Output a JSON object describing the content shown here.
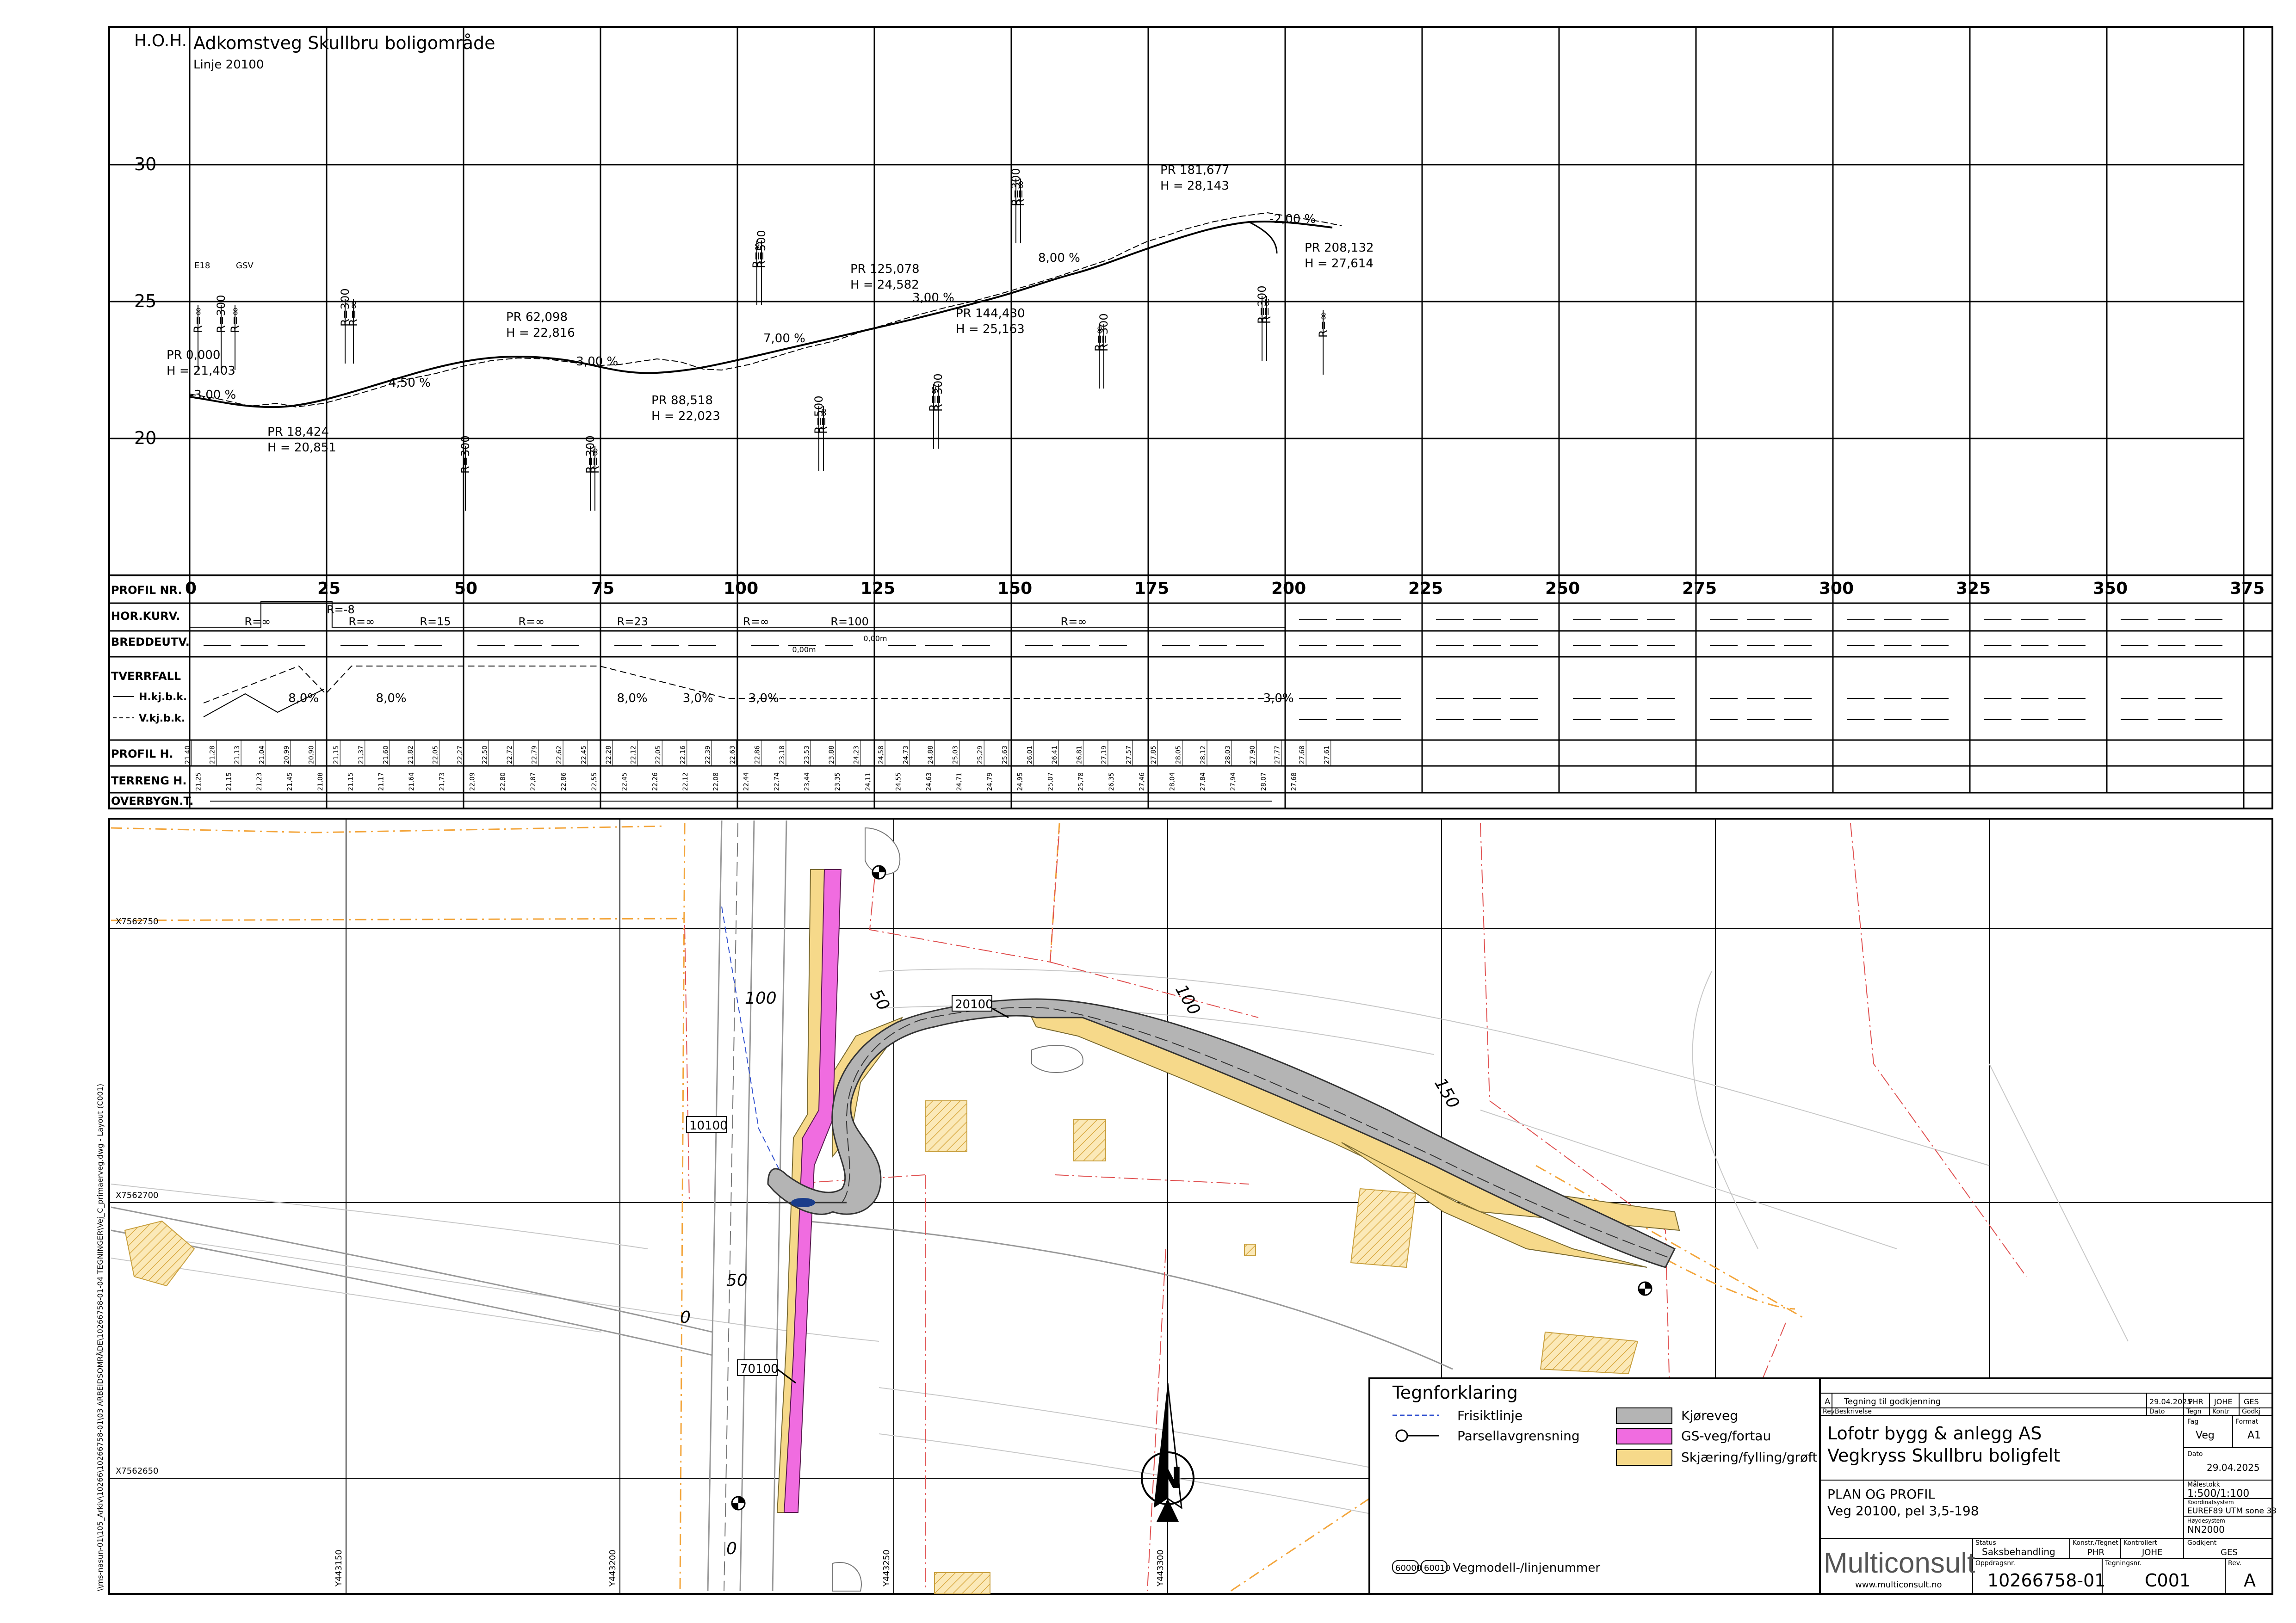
{
  "profile": {
    "title": "Adkomstveg Skullbru boligområde",
    "line": "Linje 20100",
    "hoh_label": "H.O.H.",
    "elevation_ticks": [
      "30",
      "25",
      "20"
    ],
    "station_ticks": [
      "0",
      "25",
      "50",
      "75",
      "100",
      "125",
      "150",
      "175",
      "200",
      "225",
      "250",
      "275",
      "300",
      "325",
      "350",
      "375"
    ],
    "points": [
      {
        "pr": "PR 0,000",
        "h": "H = 21,403"
      },
      {
        "pr": "PR 18,424",
        "h": "H = 20,851"
      },
      {
        "pr": "PR 62,098",
        "h": "H = 22,816"
      },
      {
        "pr": "PR 88,518",
        "h": "H = 22,023"
      },
      {
        "pr": "PR 125,078",
        "h": "H = 24,582"
      },
      {
        "pr": "PR 144,430",
        "h": "H = 25,163"
      },
      {
        "pr": "PR 181,677",
        "h": "H = 28,143"
      },
      {
        "pr": "PR 208,132",
        "h": "H = 27,614"
      }
    ],
    "grades": [
      "-3,00 %",
      "4,50 %",
      "-3,00 %",
      "7,00 %",
      "3,00 %",
      "8,00 %",
      "-2,00 %"
    ],
    "curve_labels": [
      "R=∞",
      "R=300",
      "R=∞",
      "R=300",
      "R=∞",
      "R=300",
      "R=300",
      "R=∞",
      "R=∞",
      "R=500",
      "R=500",
      "R=∞",
      "R=∞",
      "R=300",
      "R=300",
      "R=∞",
      "R=∞",
      "R=300",
      "R=300",
      "R=∞",
      "R=∞"
    ],
    "small_labels": [
      "E18",
      "GSV"
    ]
  },
  "bands": {
    "labels": [
      "PROFIL NR.",
      "HOR.KURV.",
      "BREDDEUTV.",
      "TVERRFALL",
      "H.kj.b.k.",
      "V.kj.b.k.",
      "PROFIL H.",
      "TERRENG H.",
      "OVERBYGN.T."
    ],
    "hor_kurv": [
      "R=∞",
      "R=-8",
      "R=∞",
      "R=15",
      "R=∞",
      "R=23",
      "R=∞",
      "R=100",
      "R=∞"
    ],
    "bredde": [
      "0,00m",
      "0,00m"
    ],
    "tverrfall": [
      "8,0%",
      "8,0%",
      "8,0%",
      "3,0%",
      "3,0%",
      "3,0%"
    ],
    "profil_h": [
      "21,40",
      "21,28",
      "21,13",
      "21,04",
      "20,99",
      "20,90",
      "21,15",
      "21,37",
      "21,60",
      "21,82",
      "22,05",
      "22,27",
      "22,50",
      "22,72",
      "22,79",
      "22,62",
      "22,45",
      "22,28",
      "22,12",
      "22,05",
      "22,16",
      "22,39",
      "22,63",
      "22,86",
      "23,18",
      "23,53",
      "23,88",
      "24,23",
      "24,58",
      "24,73",
      "24,88",
      "25,03",
      "25,29",
      "25,63",
      "26,01",
      "26,41",
      "26,81",
      "27,19",
      "27,57",
      "27,85",
      "28,05",
      "28,12",
      "28,03",
      "27,90",
      "27,77",
      "27,68",
      "27,61"
    ],
    "terreng_h": [
      "21,25",
      "21,15",
      "21,23",
      "21,45",
      "21,08",
      "21,15",
      "21,17",
      "21,64",
      "21,73",
      "22,09",
      "22,80",
      "22,87",
      "22,86",
      "22,55",
      "22,45",
      "22,26",
      "22,12",
      "22,08",
      "22,44",
      "22,74",
      "23,44",
      "23,35",
      "24,11",
      "24,55",
      "24,63",
      "24,71",
      "24,79",
      "24,95",
      "25,07",
      "25,78",
      "26,35",
      "27,46",
      "28,04",
      "27,84",
      "27,94",
      "28,07",
      "27,68"
    ]
  },
  "plan": {
    "grid_x": [
      "X7562750",
      "X7562700",
      "X7562650"
    ],
    "grid_y": [
      "Y443150",
      "Y443200",
      "Y443250",
      "Y443300"
    ],
    "road_labels": [
      "20100",
      "10100",
      "70100"
    ],
    "stations": [
      "100",
      "50",
      "0",
      "50",
      "100",
      "150",
      "0"
    ],
    "side_text": "\\\\ms-nasun-01\\105_Arkiv\\10266\\10266758-01\\03 ARBEIDSOMRÅDE\\10266758-01-04 TEGNINGER\\Vej_C_primaerveg.dwg - Layout (C001)"
  },
  "legend": {
    "title": "Tegnforklaring",
    "items": [
      "Frisiktlinje",
      "Parsellavgrensning",
      "Kjøreveg",
      "GS-veg/fortau",
      "Skjæring/fylling/grøft"
    ],
    "colors": {
      "kjoreveg": "#b4b4b4",
      "gsveg": "#f06ce0",
      "skjaering": "#f6d98a"
    },
    "vegmodell": "Vegmodell-/linjenummer",
    "vegmodell_boxes": [
      "60000",
      "60010"
    ]
  },
  "title_block": {
    "revision_row": {
      "rev": "A",
      "text": "Tegning til godkjenning",
      "date": "29.04.2025",
      "by1": "PHR",
      "by2": "JOHE",
      "by3": "GES"
    },
    "headers": [
      "Rev.",
      "Beskrivelse",
      "Dato",
      "Tegn",
      "Kontr",
      "Godkj"
    ],
    "client": "Lofotr bygg & anlegg AS",
    "project": "Vegkryss Skullbru boligfelt",
    "fag_label": "Fag",
    "fag": "Veg",
    "format_label": "Format",
    "format": "A1",
    "dato_label": "Dato",
    "dato": "29.04.2025",
    "drawing_title": "PLAN OG PROFIL",
    "drawing_sub": "Veg 20100, pel 3,5-198",
    "malestokk_label": "Målestokk",
    "malestokk": "1:500/1:100",
    "koord_label": "Koordinatsystem",
    "koord": "EUREF89 UTM sone 33",
    "hoyde_label": "Høydesystem",
    "hoyde": "NN2000",
    "status_label": "Status",
    "status": "Saksbehandling",
    "konstr_label": "Konstr./Tegnet",
    "konstr": "PHR",
    "kontr_label": "Kontrollert",
    "kontr": "JOHE",
    "godkj_label": "Godkjent",
    "godkj": "GES",
    "company": "Multiconsult",
    "website": "www.multiconsult.no",
    "oppdrag_label": "Oppdragsnr.",
    "oppdrag": "10266758-01",
    "tegning_label": "Tegningsnr.",
    "tegning": "C001",
    "rev_label": "Rev.",
    "rev": "A"
  },
  "north": "N"
}
